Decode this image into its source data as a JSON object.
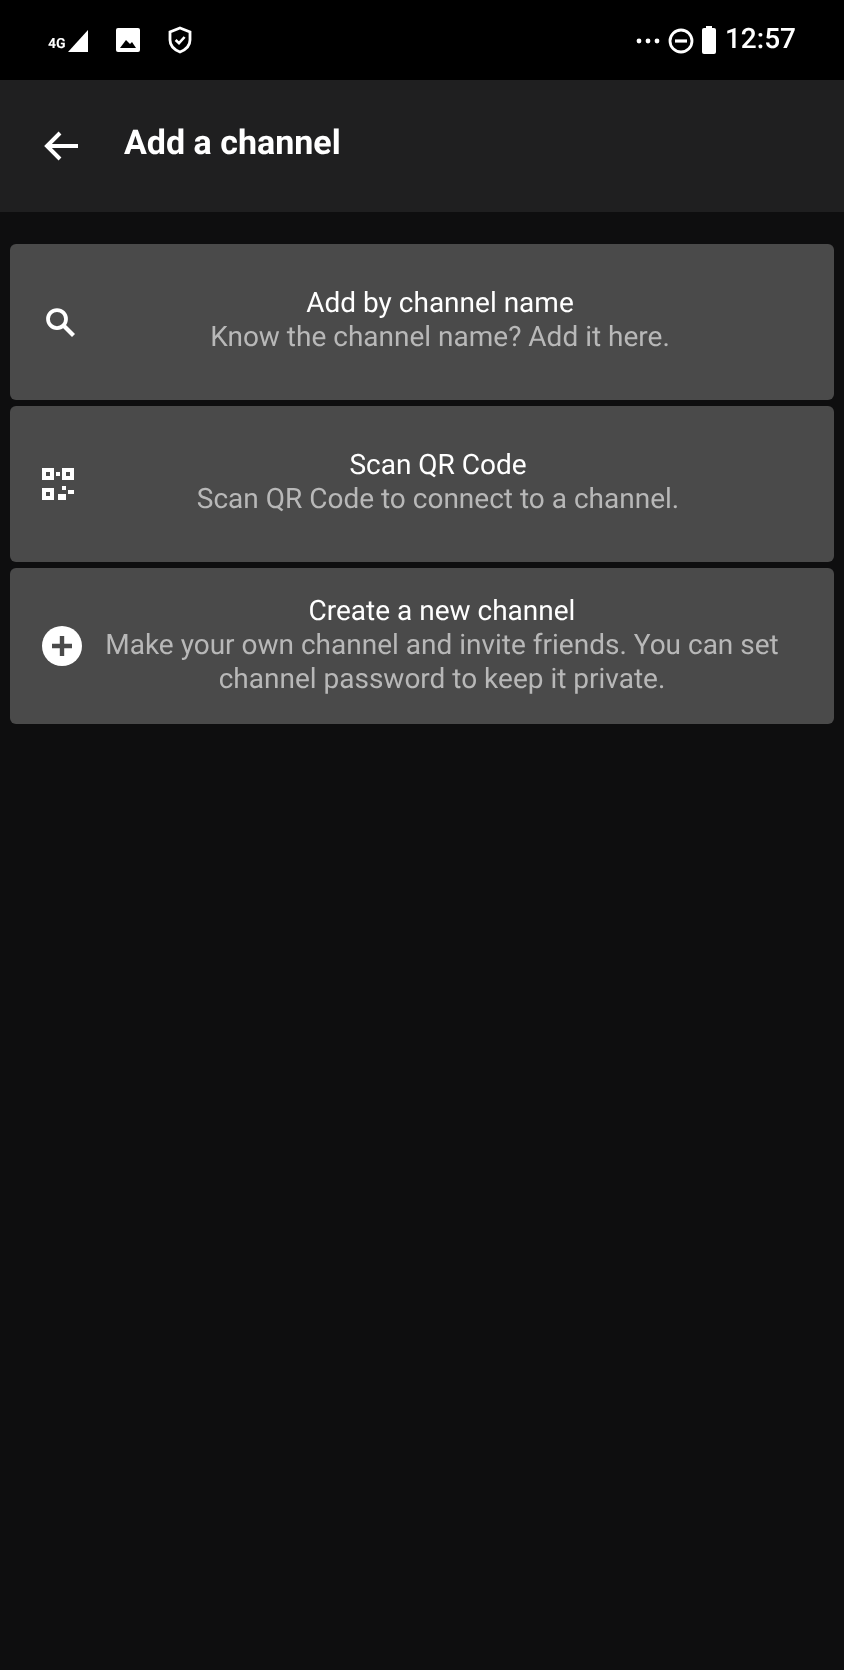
{
  "status_bar": {
    "network": "4G",
    "time": "12:57"
  },
  "app_bar": {
    "title": "Add a channel"
  },
  "options": [
    {
      "kind": "search",
      "title": "Add by channel name",
      "subtitle": "Know the channel name? Add it here."
    },
    {
      "kind": "qr",
      "title": "Scan QR Code",
      "subtitle": "Scan QR Code to connect to a channel."
    },
    {
      "kind": "add",
      "title": "Create a new channel",
      "subtitle": "Make your own channel and invite friends. You can set channel password to keep it private."
    }
  ]
}
